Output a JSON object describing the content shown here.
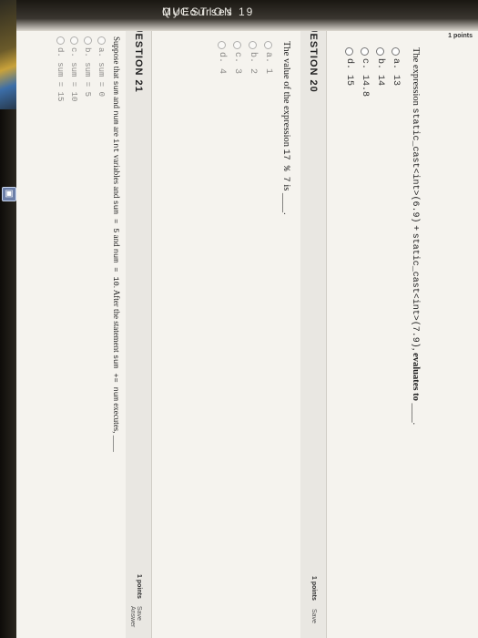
{
  "header": {
    "section_label": "QUESTION 19",
    "brand": "MyCourses",
    "points_label": "1 points"
  },
  "q19": {
    "prefix": "The expression",
    "code1": "static_cast<int>(6.9)",
    "plus": "+",
    "code2": "static_cast<int>(7.9)",
    "suffix": "evaluates to",
    "blank": "____.",
    "options": [
      "a. 13",
      "b. 14",
      "c. 14.8",
      "d. 15"
    ]
  },
  "q20": {
    "title": "QUESTION 20",
    "points": "1 points",
    "save": "Save",
    "prefix": "The value of the expression",
    "code": "17 % 7",
    "suffix": "is",
    "blank": "____.",
    "options": [
      "a. 1",
      "b. 2",
      "c. 3",
      "d. 4"
    ]
  },
  "q21": {
    "title": "QUESTION 21",
    "points": "1 points",
    "save": "Save Answer",
    "t1": "Suppose that",
    "c1": "sum",
    "t2": "and",
    "c2": "num",
    "t3": "are",
    "c3": "int",
    "t4": "variables and",
    "c4": "sum = 5",
    "t5": "and",
    "c5": "num = 10",
    "t6": ". After the statement",
    "c6": "sum += num",
    "t7": "executes,",
    "blank": "____",
    "options": [
      "a. sum = 0",
      "b. sum = 5",
      "c. sum = 10",
      "d. sum = 15"
    ]
  }
}
